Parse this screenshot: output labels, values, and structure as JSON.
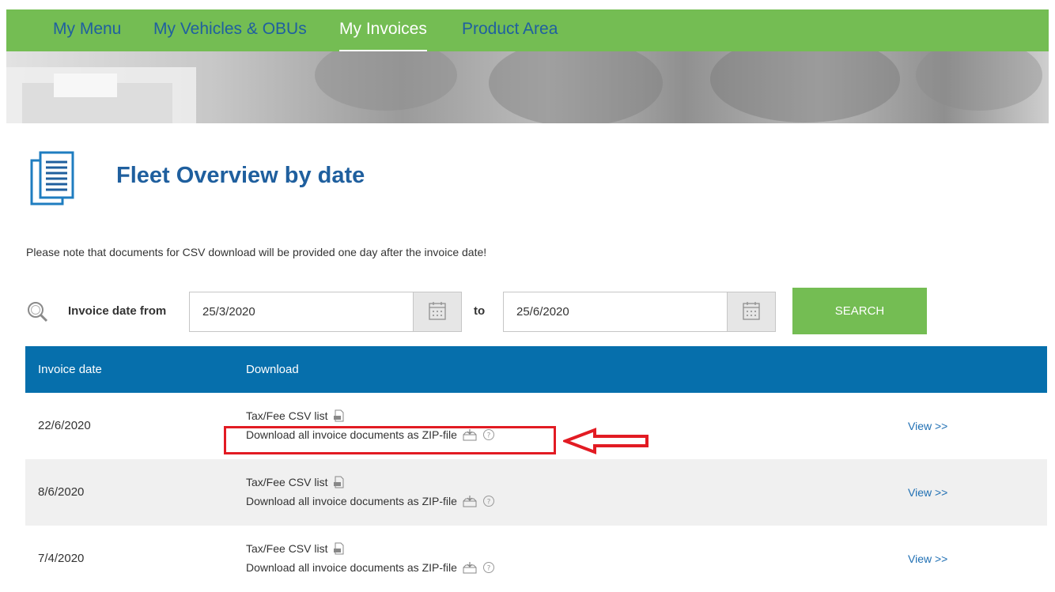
{
  "nav": {
    "items": [
      {
        "label": "My Menu",
        "active": false
      },
      {
        "label": "My Vehicles & OBUs",
        "active": false
      },
      {
        "label": "My Invoices",
        "active": true
      },
      {
        "label": "Product Area",
        "active": false
      }
    ]
  },
  "page": {
    "title": "Fleet Overview by date",
    "note": "Please note that documents for CSV download will be provided one day after the invoice date!"
  },
  "search": {
    "from_label": "Invoice date from",
    "from_value": "25/3/2020",
    "to_label": "to",
    "to_value": "25/6/2020",
    "button_label": "SEARCH"
  },
  "table": {
    "headers": {
      "date": "Invoice date",
      "download": "Download"
    },
    "rows": [
      {
        "date": "22/6/2020",
        "csv": "Tax/Fee CSV list",
        "zip": "Download all invoice documents as ZIP-file",
        "view": "View >>"
      },
      {
        "date": "8/6/2020",
        "csv": "Tax/Fee CSV list",
        "zip": "Download all invoice documents as ZIP-file",
        "view": "View >>"
      },
      {
        "date": "7/4/2020",
        "csv": "Tax/Fee CSV list",
        "zip": "Download all invoice documents as ZIP-file",
        "view": "View >>"
      }
    ]
  },
  "colors": {
    "nav_bg": "#74bd53",
    "nav_text": "#1f5fa0",
    "title": "#1f5f9e",
    "table_header": "#066fac",
    "link": "#1f6fb3",
    "annotation": "#e21b23"
  },
  "icons": {
    "page": "document-list-icon",
    "search": "magnifier-icon",
    "calendar": "calendar-icon",
    "csv": "csv-file-icon",
    "zip": "zip-download-icon",
    "help": "help-circle-icon"
  }
}
